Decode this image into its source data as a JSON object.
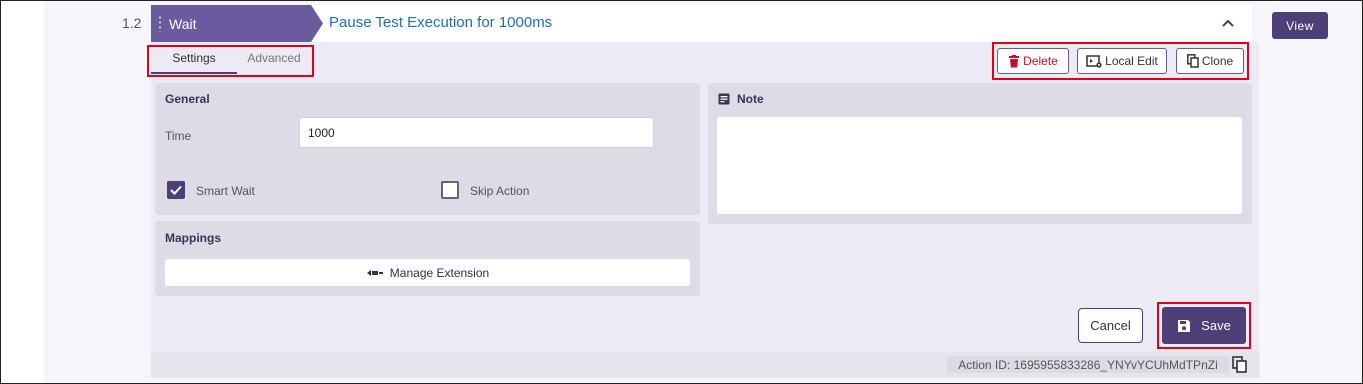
{
  "step": {
    "number": "1.2",
    "type_label": "Wait",
    "title": "Pause Test Execution for 1000ms"
  },
  "view_button": "View",
  "tabs": [
    {
      "label": "Settings",
      "active": true
    },
    {
      "label": "Advanced",
      "active": false
    }
  ],
  "actions": {
    "delete": "Delete",
    "local_edit": "Local Edit",
    "clone": "Clone"
  },
  "general": {
    "title": "General",
    "time_label": "Time",
    "time_value": "1000",
    "smart_wait_label": "Smart Wait",
    "smart_wait_checked": true,
    "skip_action_label": "Skip Action",
    "skip_action_checked": false
  },
  "note": {
    "title": "Note",
    "value": ""
  },
  "mappings": {
    "title": "Mappings",
    "manage_extension": "Manage Extension"
  },
  "buttons": {
    "cancel": "Cancel",
    "save": "Save"
  },
  "footer": {
    "action_id": "Action ID: 1695955833286_YNYvYCUhMdTPnZi"
  },
  "colors": {
    "accent": "#4e3f78",
    "wait_tag": "#6b5a9e",
    "title_link": "#1f6fb3",
    "delete": "#c4122e",
    "highlight": "#e0001a"
  }
}
